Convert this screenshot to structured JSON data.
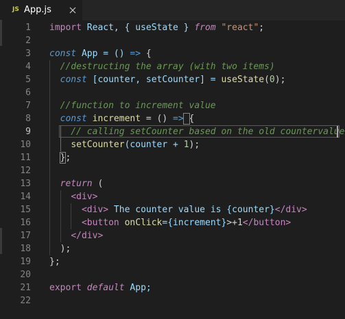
{
  "tab": {
    "badge": "JS",
    "filename": "App.js"
  },
  "colors": {
    "keyword": "#569cd6",
    "control": "#c586c0",
    "variable": "#9cdcfe",
    "function": "#dcdcaa",
    "string": "#ce9178",
    "number": "#b5cea8",
    "comment": "#6a9955",
    "plain": "#d4d4d4"
  },
  "lines": [
    {
      "n": "1",
      "tokens": [
        {
          "t": "import",
          "c": "#c586c0"
        },
        {
          "t": " React, { useState } ",
          "c": "#9cdcfe"
        },
        {
          "t": "from",
          "c": "#c586c0",
          "i": true
        },
        {
          "t": " ",
          "c": "#d4d4d4"
        },
        {
          "t": "\"react\"",
          "c": "#ce9178"
        },
        {
          "t": ";",
          "c": "#d4d4d4"
        }
      ]
    },
    {
      "n": "2",
      "tokens": []
    },
    {
      "n": "3",
      "tokens": [
        {
          "t": "const",
          "c": "#569cd6",
          "i": true
        },
        {
          "t": " App = () ",
          "c": "#9cdcfe"
        },
        {
          "t": "=>",
          "c": "#569cd6"
        },
        {
          "t": " {",
          "c": "#d4d4d4"
        }
      ]
    },
    {
      "n": "4",
      "tokens": [
        {
          "t": "  //destructing the array (with two items)",
          "c": "#6a9955",
          "i": true
        }
      ]
    },
    {
      "n": "5",
      "tokens": [
        {
          "t": "  ",
          "c": "#d4d4d4"
        },
        {
          "t": "const",
          "c": "#569cd6",
          "i": true
        },
        {
          "t": " [counter, setCounter] = ",
          "c": "#9cdcfe"
        },
        {
          "t": "useState",
          "c": "#dcdcaa"
        },
        {
          "t": "(",
          "c": "#d4d4d4"
        },
        {
          "t": "0",
          "c": "#b5cea8"
        },
        {
          "t": ");",
          "c": "#d4d4d4"
        }
      ]
    },
    {
      "n": "6",
      "tokens": []
    },
    {
      "n": "7",
      "tokens": [
        {
          "t": "  //function to increment value",
          "c": "#6a9955",
          "i": true
        }
      ]
    },
    {
      "n": "8",
      "tokens": [
        {
          "t": "  ",
          "c": "#d4d4d4"
        },
        {
          "t": "const",
          "c": "#569cd6",
          "i": true
        },
        {
          "t": " increment",
          "c": "#dcdcaa"
        },
        {
          "t": " = () ",
          "c": "#d4d4d4"
        },
        {
          "t": "=>",
          "c": "#569cd6"
        },
        {
          "t": " {",
          "c": "#d4d4d4"
        }
      ]
    },
    {
      "n": "9",
      "tokens": [
        {
          "t": "    // calling setCounter based on the old countervalue",
          "c": "#6a9955",
          "i": true
        }
      ]
    },
    {
      "n": "10",
      "tokens": [
        {
          "t": "    ",
          "c": "#d4d4d4"
        },
        {
          "t": "setCounter",
          "c": "#dcdcaa"
        },
        {
          "t": "(counter + ",
          "c": "#9cdcfe"
        },
        {
          "t": "1",
          "c": "#b5cea8"
        },
        {
          "t": ");",
          "c": "#d4d4d4"
        }
      ]
    },
    {
      "n": "11",
      "tokens": [
        {
          "t": "  };",
          "c": "#d4d4d4"
        }
      ]
    },
    {
      "n": "12",
      "tokens": []
    },
    {
      "n": "13",
      "tokens": [
        {
          "t": "  ",
          "c": "#d4d4d4"
        },
        {
          "t": "return",
          "c": "#c586c0",
          "i": true
        },
        {
          "t": " (",
          "c": "#d4d4d4"
        }
      ]
    },
    {
      "n": "14",
      "tokens": [
        {
          "t": "    ",
          "c": "#d4d4d4"
        },
        {
          "t": "<div>",
          "c": "#c586c0"
        }
      ]
    },
    {
      "n": "15",
      "tokens": [
        {
          "t": "      ",
          "c": "#d4d4d4"
        },
        {
          "t": "<div>",
          "c": "#c586c0"
        },
        {
          "t": " The counter value is {counter}",
          "c": "#9cdcfe"
        },
        {
          "t": "</div>",
          "c": "#c586c0"
        }
      ]
    },
    {
      "n": "16",
      "tokens": [
        {
          "t": "      ",
          "c": "#d4d4d4"
        },
        {
          "t": "<button",
          "c": "#c586c0"
        },
        {
          "t": " onClick",
          "c": "#dcdcaa"
        },
        {
          "t": "={increment}",
          "c": "#9cdcfe"
        },
        {
          "t": ">+1",
          "c": "#d4d4d4"
        },
        {
          "t": "</button>",
          "c": "#c586c0"
        }
      ]
    },
    {
      "n": "17",
      "tokens": [
        {
          "t": "    ",
          "c": "#d4d4d4"
        },
        {
          "t": "</div>",
          "c": "#c586c0"
        }
      ]
    },
    {
      "n": "18",
      "tokens": [
        {
          "t": "  );",
          "c": "#d4d4d4"
        }
      ]
    },
    {
      "n": "19",
      "tokens": [
        {
          "t": "};",
          "c": "#d4d4d4"
        }
      ]
    },
    {
      "n": "20",
      "tokens": []
    },
    {
      "n": "21",
      "tokens": [
        {
          "t": "export",
          "c": "#c586c0"
        },
        {
          "t": " ",
          "c": "#d4d4d4"
        },
        {
          "t": "default",
          "c": "#c586c0",
          "i": true
        },
        {
          "t": " App;",
          "c": "#9cdcfe"
        }
      ]
    },
    {
      "n": "22",
      "tokens": []
    }
  ]
}
